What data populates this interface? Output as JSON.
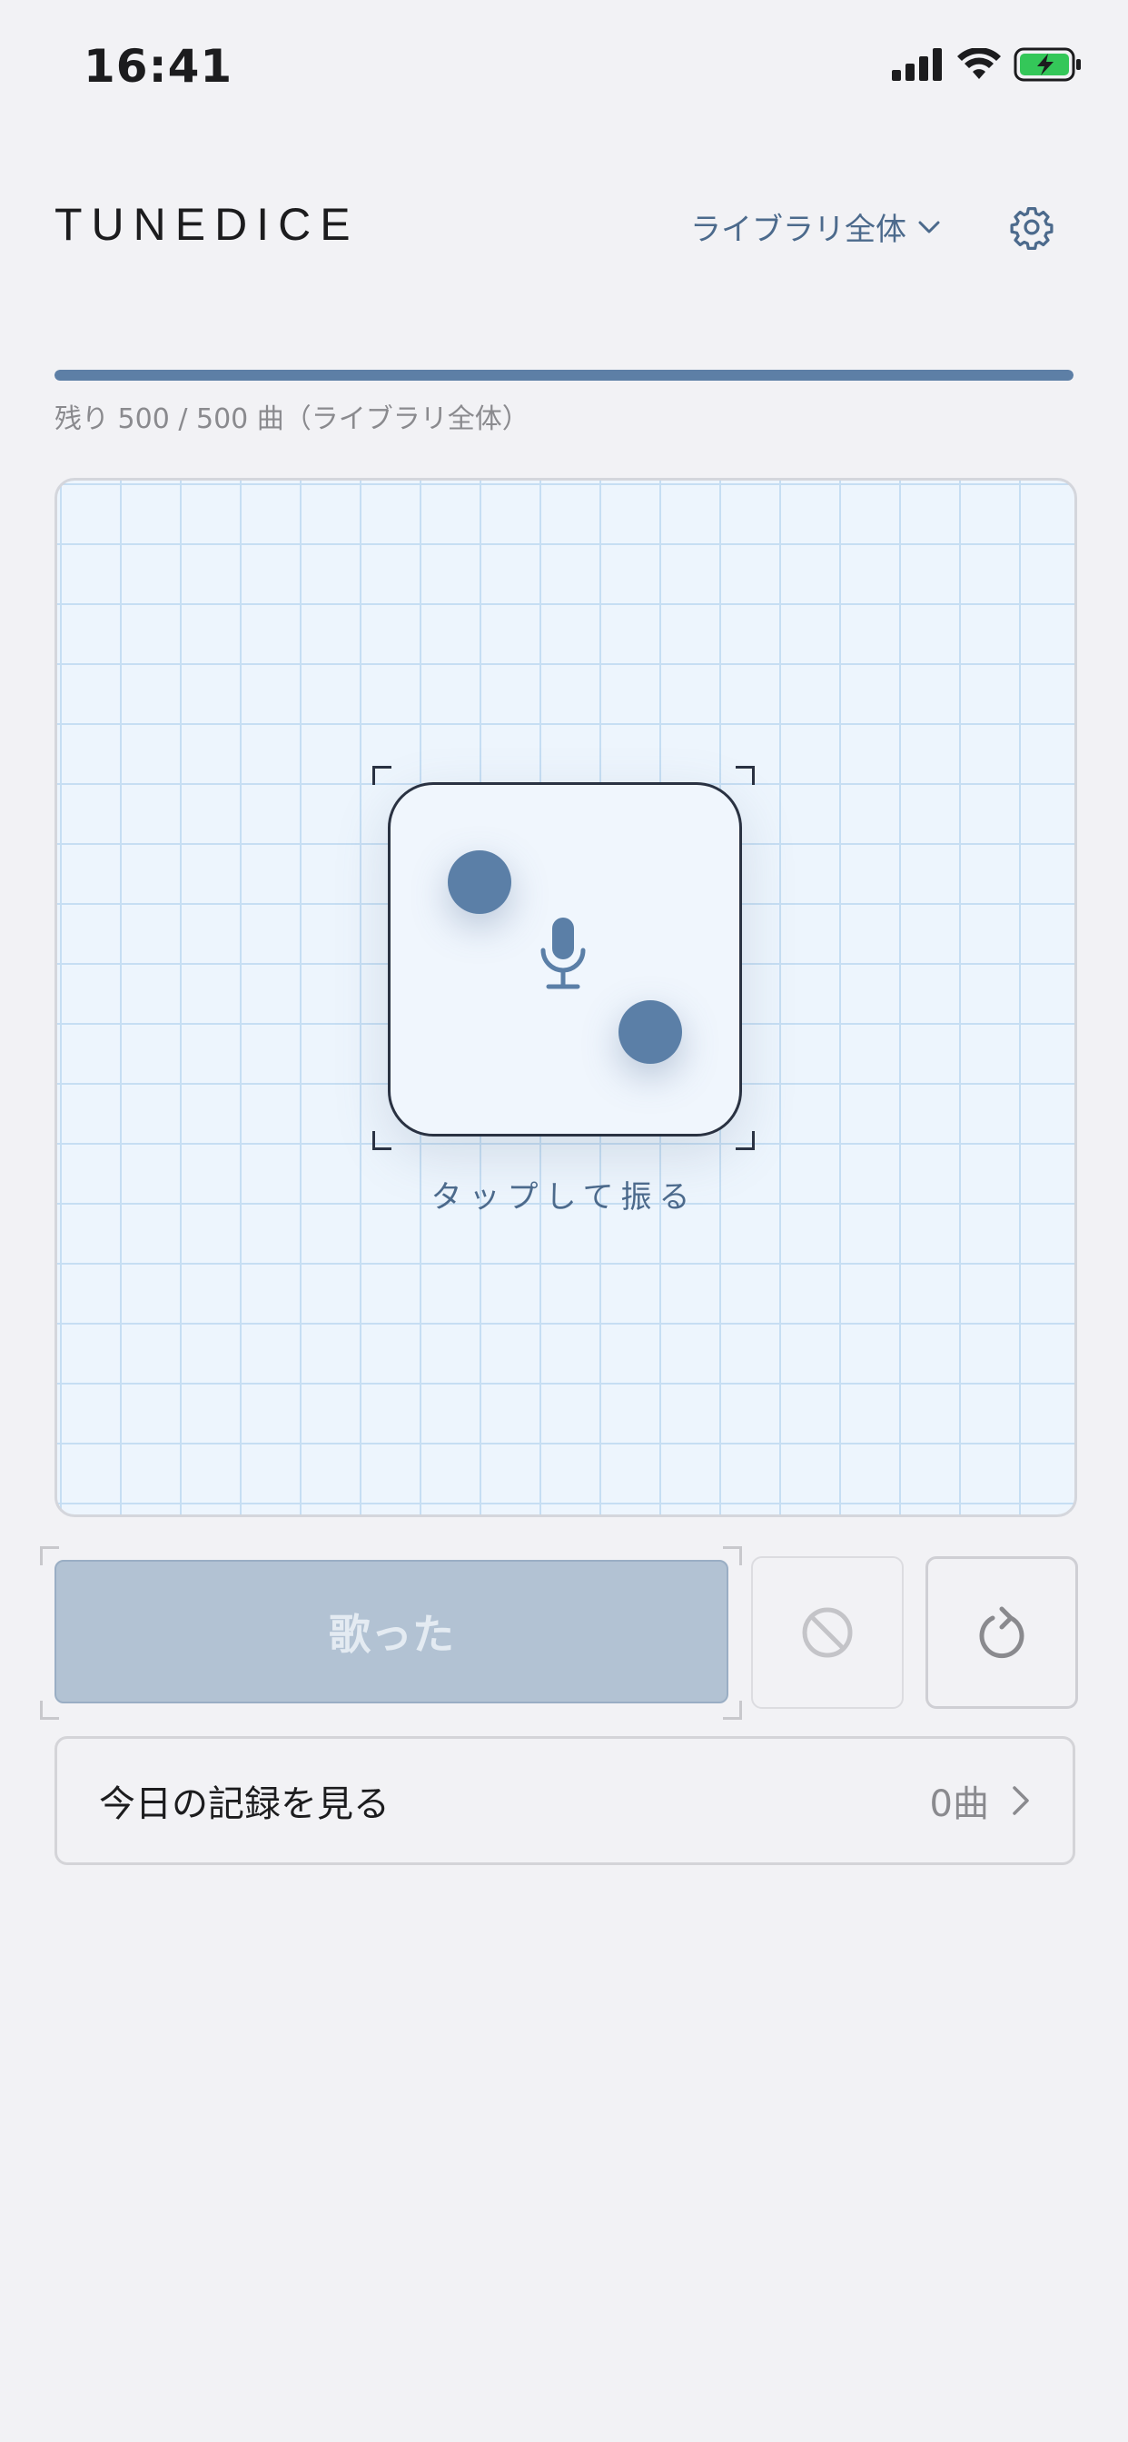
{
  "status_bar": {
    "time": "16:41"
  },
  "header": {
    "title": "TUNEDICE",
    "scope_label": "ライブラリ全体",
    "settings_icon": "gear-icon"
  },
  "progress": {
    "fraction": 1.0,
    "text": "残り 500 / 500 曲（ライブラリ全体）"
  },
  "dice": {
    "tap_label": "タップして振る",
    "center_icon": "microphone-icon"
  },
  "actions": {
    "sang_label": "歌った",
    "skip_icon": "prohibit-icon",
    "reroll_icon": "refresh-icon"
  },
  "history": {
    "label": "今日の記録を見る",
    "count": "0曲"
  },
  "colors": {
    "accent": "#5d7fa6",
    "pip": "#5b7fa7",
    "grid_line": "#c6def3",
    "sang_button": "#b2c2d3"
  }
}
